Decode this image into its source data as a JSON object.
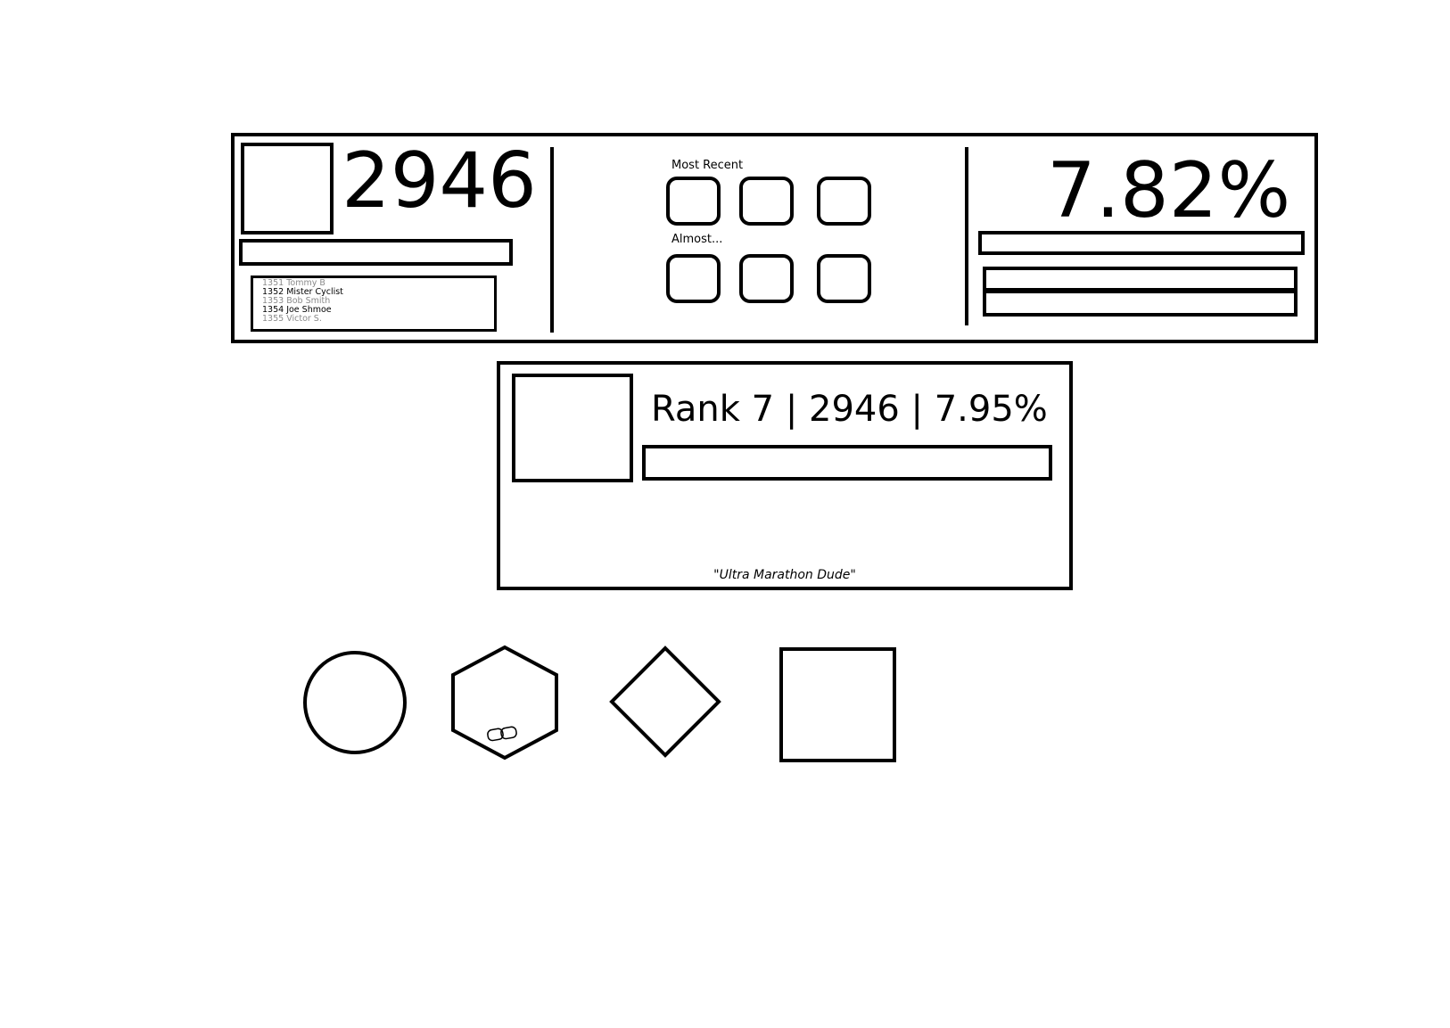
{
  "summary_panel": {
    "total_points": "2946",
    "leaderboard": [
      {
        "text": "1351 Tommy B",
        "faded": true
      },
      {
        "text": "1352 Mister Cyclist",
        "faded": false
      },
      {
        "text": "1353 Bob Smith",
        "faded": true
      },
      {
        "text": "1354 Joe Shmoe",
        "faded": false
      },
      {
        "text": "1355 Victor S.",
        "faded": true
      }
    ],
    "most_recent_label": "Most Recent",
    "almost_label": "Almost...",
    "percentage": "7.82%"
  },
  "profile_card": {
    "stats": "Rank 7 | 2946 | 7.95%",
    "motto": "\"Ultra Marathon Dude\""
  },
  "shapes": [
    "circle",
    "hexagon",
    "diamond",
    "square"
  ],
  "icons": {
    "hexagon_emblem": "link-icon"
  }
}
